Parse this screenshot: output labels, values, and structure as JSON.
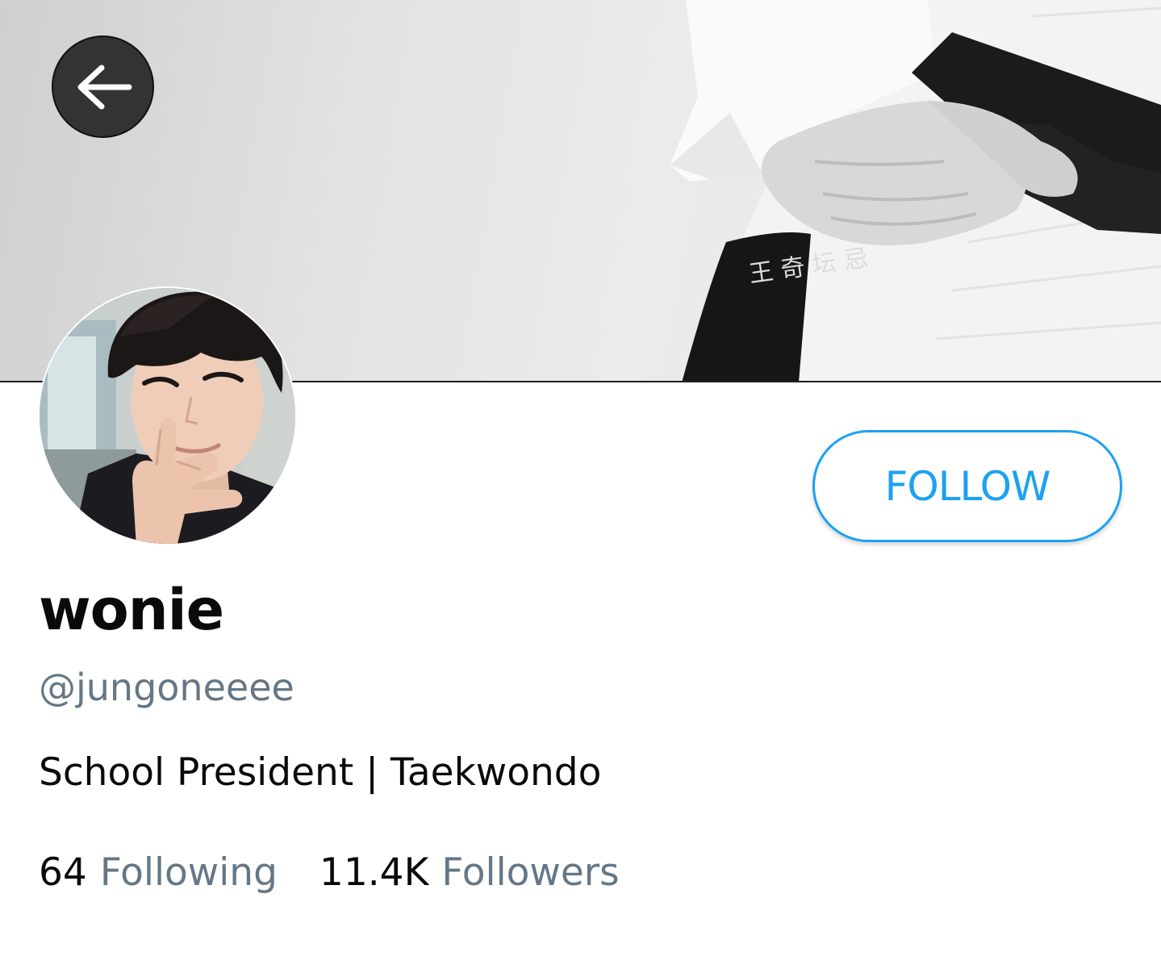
{
  "header": {
    "back_icon": "arrow-left-icon",
    "banner_belt_text": "王 奇 坛 忌"
  },
  "profile": {
    "display_name": "wonie",
    "handle": "@jungoneeee",
    "bio": "School President | Taekwondo",
    "follow_label": "FOLLOW",
    "following_count": "64",
    "following_label": "Following",
    "followers_count": "11.4K",
    "followers_label": "Followers"
  },
  "colors": {
    "accent": "#1da1f2",
    "secondary_text": "#657786",
    "primary_text": "#0a0a0a",
    "back_button_bg": "#333333"
  }
}
